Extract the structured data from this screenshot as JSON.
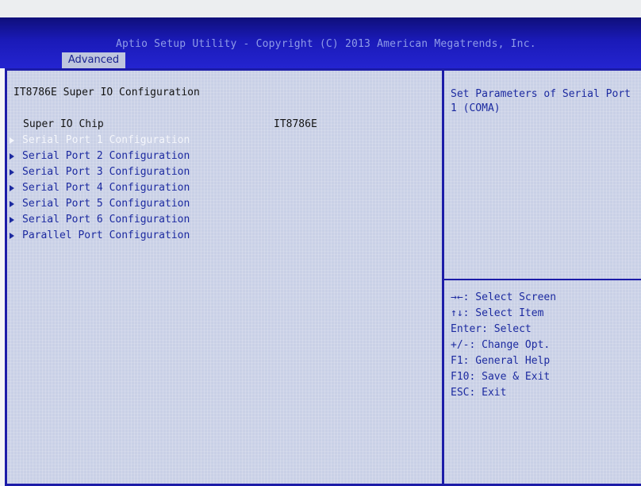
{
  "header": {
    "title": "Aptio Setup Utility - Copyright (C) 2013 American Megatrends, Inc.",
    "active_tab": "Advanced"
  },
  "main": {
    "heading": "IT8786E Super IO Configuration",
    "chip": {
      "label": "Super IO Chip",
      "value": "IT8786E"
    },
    "items": [
      {
        "label": "Serial Port 1 Configuration",
        "selected": true
      },
      {
        "label": "Serial Port 2 Configuration",
        "selected": false
      },
      {
        "label": "Serial Port 3 Configuration",
        "selected": false
      },
      {
        "label": "Serial Port 4 Configuration",
        "selected": false
      },
      {
        "label": "Serial Port 5 Configuration",
        "selected": false
      },
      {
        "label": "Serial Port 6 Configuration",
        "selected": false
      },
      {
        "label": "Parallel Port Configuration",
        "selected": false
      }
    ]
  },
  "help": {
    "description_line1": "Set Parameters of Serial Port",
    "description_line2": "1 (COMA)",
    "keys": [
      "→←: Select Screen",
      "↑↓: Select Item",
      "Enter: Select",
      "+/-: Change Opt.",
      "F1: General Help",
      "F10: Save & Exit",
      "ESC: Exit"
    ]
  },
  "colors": {
    "title_bar": "#1a1ab8",
    "panel": "#c9d0e6",
    "item_text": "#1c2aa0",
    "selected_text": "#f4f6fb"
  }
}
